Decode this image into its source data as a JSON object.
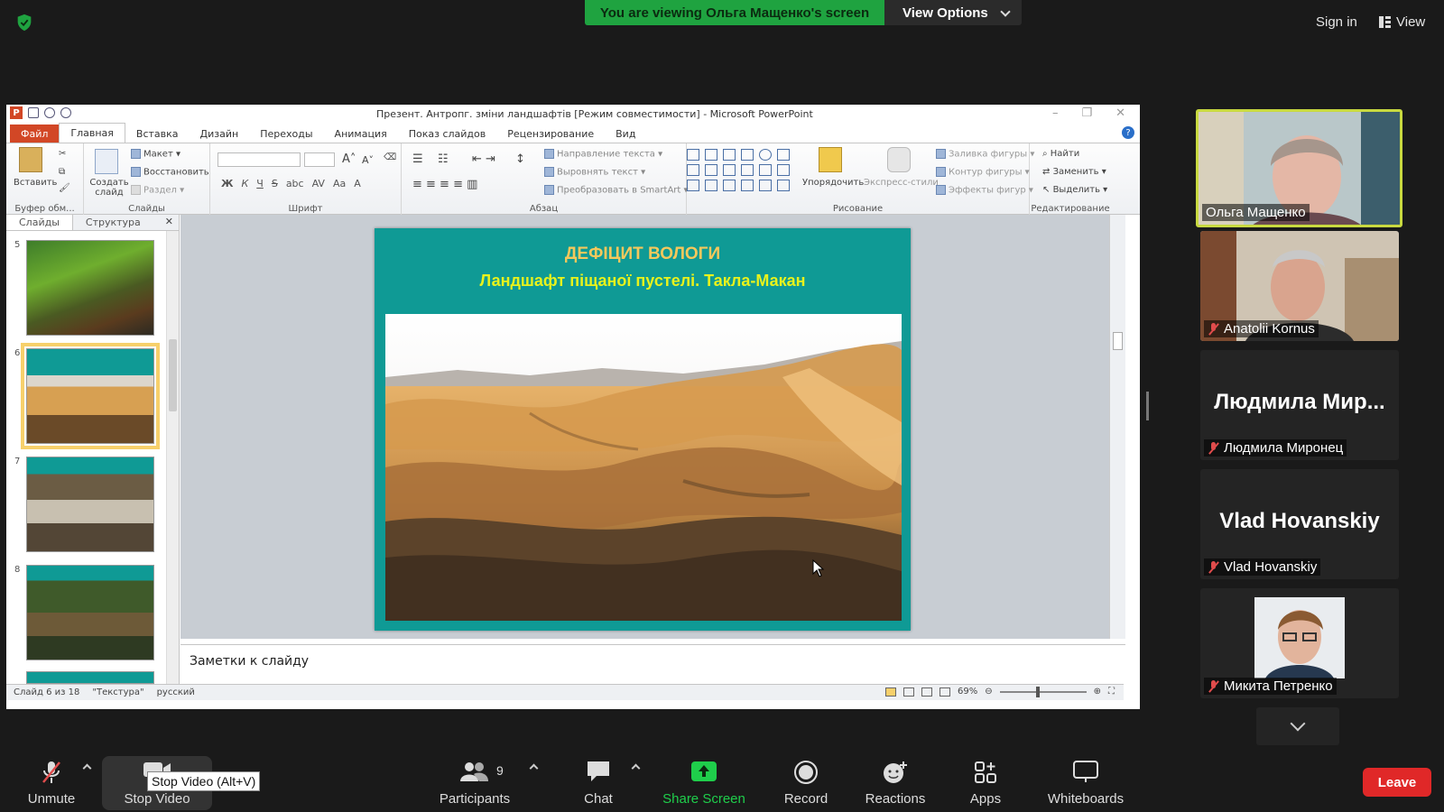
{
  "top": {
    "viewing_banner": "You are viewing Ольга Мащенко's screen",
    "view_options": "View Options",
    "sign_in": "Sign in",
    "view": "View",
    "colors": {
      "banner": "#1fa340",
      "shield": "#1fa340"
    }
  },
  "ppt": {
    "window_title": "Презент. Антропг. зміни ландшафтів [Режим совместимости]  -  Microsoft PowerPoint",
    "tabs": [
      "Файл",
      "Главная",
      "Вставка",
      "Дизайн",
      "Переходы",
      "Анимация",
      "Показ слайдов",
      "Рецензирование",
      "Вид"
    ],
    "ribbon": {
      "groups": [
        "Буфер обм...",
        "Слайды",
        "Шрифт",
        "Абзац",
        "Рисование",
        "Редактирование"
      ],
      "paste": "Вставить",
      "new_slide": "Создать слайд",
      "layout": "Макет",
      "reset": "Восстановить",
      "section": "Раздел",
      "text_direction": "Направление текста",
      "align_text": "Выровнять текст",
      "smartart": "Преобразовать в SmartArt",
      "arrange": "Упорядочить",
      "quick_styles": "Экспресс-стили",
      "shape_fill": "Заливка фигуры",
      "shape_outline": "Контур фигуры",
      "shape_effects": "Эффекты фигур",
      "find": "Найти",
      "replace": "Заменить",
      "select": "Выделить"
    },
    "pane_tabs": [
      "Слайды",
      "Структура"
    ],
    "thumbnails": [
      {
        "num": "5",
        "theme": "moss"
      },
      {
        "num": "6",
        "theme": "desert",
        "selected": true
      },
      {
        "num": "7",
        "theme": "flood"
      },
      {
        "num": "8",
        "theme": "forest"
      }
    ],
    "slide": {
      "title": "ДЕФІЦИТ ВОЛОГИ",
      "subtitle": "Ландшафт піщаної пустелі. Такла-Макан"
    },
    "notes_placeholder": "Заметки к слайду",
    "status": {
      "slide_of": "Слайд 6 из 18",
      "theme": "\"Текстура\"",
      "language": "русский",
      "zoom": "69%"
    }
  },
  "participants": [
    {
      "name": "Ольга Мащенко",
      "video": true,
      "active": true
    },
    {
      "name": "Anatolii Kornus",
      "video": true,
      "muted": true
    },
    {
      "name": "Людмила Миронец",
      "display_name": "Людмила  Мир...",
      "video": false,
      "muted": true
    },
    {
      "name": "Vlad Hovanskiy",
      "display_name": "Vlad Hovanskiy",
      "video": false,
      "muted": true
    },
    {
      "name": "Микита Петренко",
      "video": true,
      "muted": true
    }
  ],
  "toolbar": {
    "unmute": "Unmute",
    "stop_video": "Stop Video",
    "tooltip": "Stop Video (Alt+V)",
    "participants": "Participants",
    "participants_count": "9",
    "chat": "Chat",
    "share_screen": "Share Screen",
    "record": "Record",
    "reactions": "Reactions",
    "apps": "Apps",
    "whiteboards": "Whiteboards",
    "leave": "Leave",
    "colors": {
      "share": "#1fce4b",
      "leave": "#e02828"
    }
  }
}
